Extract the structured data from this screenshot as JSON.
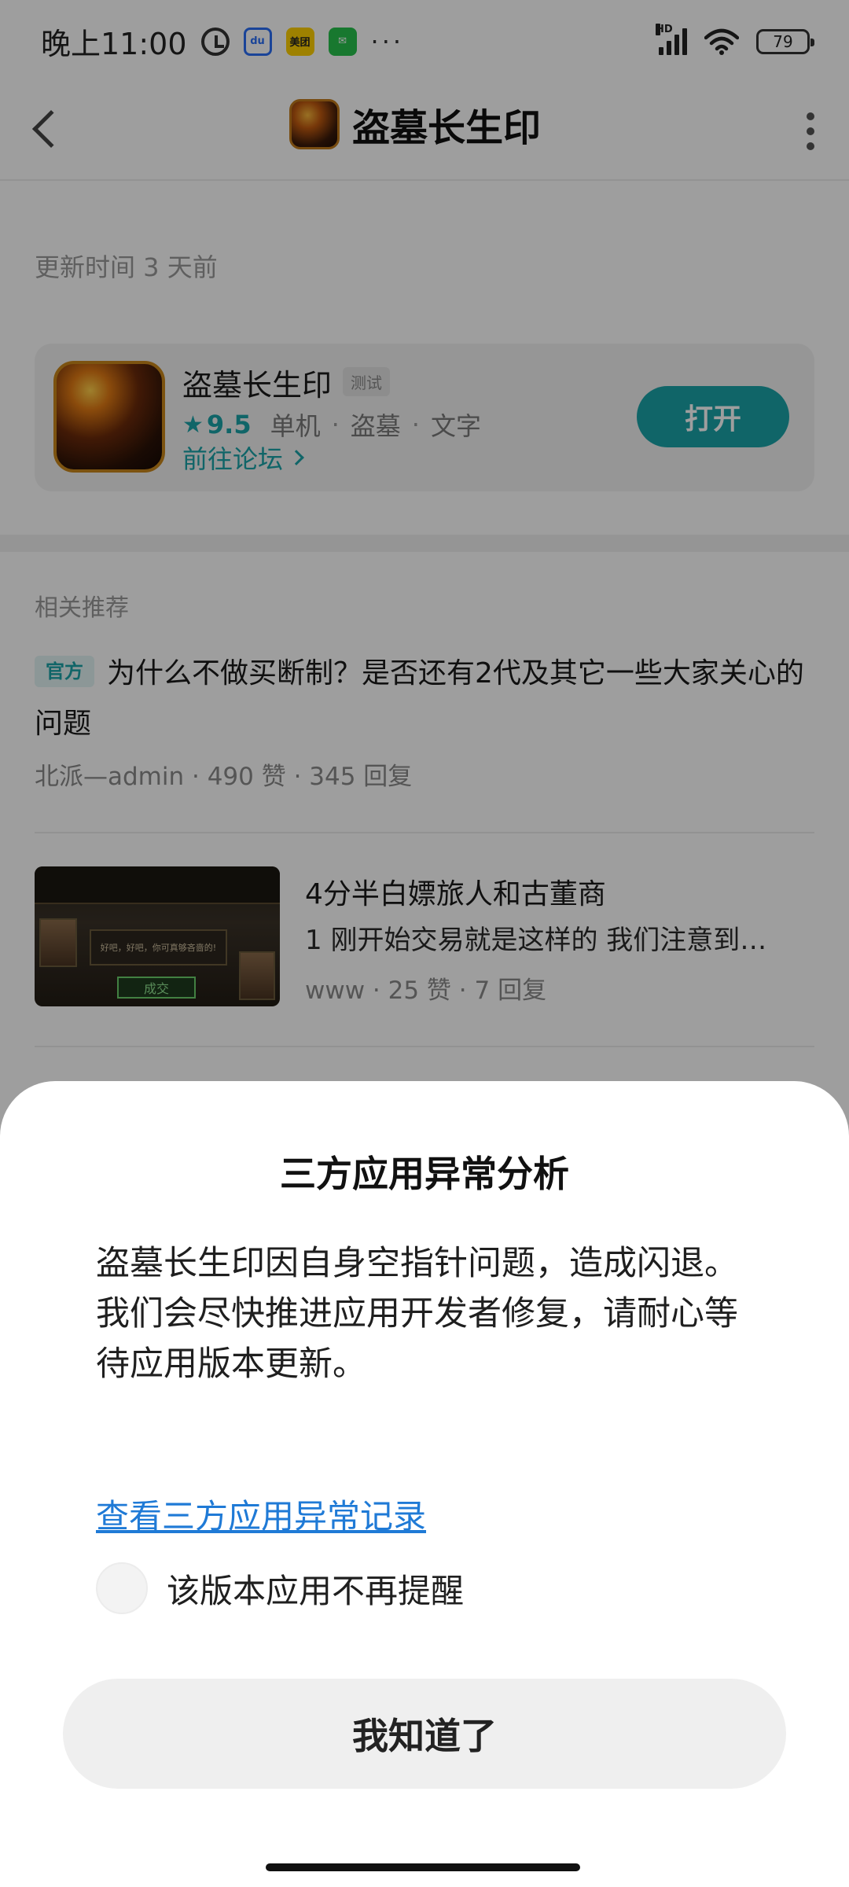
{
  "status_bar": {
    "time": "晚上11:00",
    "notification_icons": [
      "alarm-icon",
      "baidu-icon",
      "meituan-icon",
      "wechat-icon"
    ],
    "more": "···",
    "signal_label": "HD",
    "battery": "79"
  },
  "nav": {
    "title": "盗墓长生印"
  },
  "update_time": "更新时间 3 天前",
  "app_card": {
    "name": "盗墓长生印",
    "badge": "测试",
    "rating": "9.5",
    "tags": [
      "单机",
      "盗墓",
      "文字"
    ],
    "forum_link": "前往论坛",
    "open_button": "打开"
  },
  "recommend": {
    "section_title": "相关推荐",
    "posts": [
      {
        "badge": "官方",
        "title": "为什么不做买断制？是否还有2代及其它一些大家关心的问题",
        "meta": "北派—admin · 490 赞 · 345 回复"
      },
      {
        "title": "4分半白嫖旅人和古董商",
        "excerpt": "1 刚开始交易就是这样的 我们注意到…",
        "meta": "www · 25 赞 · 7 回复",
        "thumb_button": "成交"
      }
    ]
  },
  "sheet": {
    "title": "三方应用异常分析",
    "message_lines": [
      "盗墓长生印因自身空指针问题，造成闪退。",
      "我们会尽快推进应用开发者修复，请耐心等待应用版本更新。"
    ],
    "records_link": "查看三方应用异常记录",
    "remind_label": "该版本应用不再提醒",
    "ok_button": "我知道了"
  },
  "colors": {
    "accent": "#1aa3a8",
    "link": "#1f7ad6"
  }
}
